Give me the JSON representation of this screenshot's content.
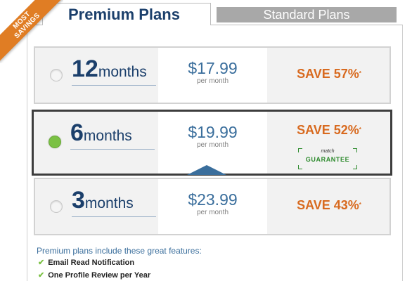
{
  "ribbon": {
    "line1": "MOST",
    "line2": "SAVINGS"
  },
  "tabs": {
    "premium": "Premium Plans",
    "standard": "Standard Plans"
  },
  "plans": [
    {
      "number": "12",
      "unit": "months",
      "price": "$17.99",
      "per": "per month",
      "save": "SAVE 57%",
      "mark": "*",
      "selected": false
    },
    {
      "number": "6",
      "unit": "months",
      "price": "$19.99",
      "per": "per month",
      "save": "SAVE 52%",
      "mark": "*",
      "selected": true
    },
    {
      "number": "3",
      "unit": "months",
      "price": "$23.99",
      "per": "per month",
      "save": "SAVE 43%",
      "mark": "*",
      "selected": false
    }
  ],
  "guarantee": {
    "brand": "match",
    "word": "GUARANTEE"
  },
  "features": {
    "intro": "Premium plans include these great features:",
    "items": [
      "Email Read Notification",
      "One Profile Review per Year"
    ]
  },
  "colors": {
    "navy": "#1b3f6b",
    "accent_orange": "#d86a1f",
    "price_blue": "#3a6e9c",
    "selected_green": "#7bc144"
  }
}
